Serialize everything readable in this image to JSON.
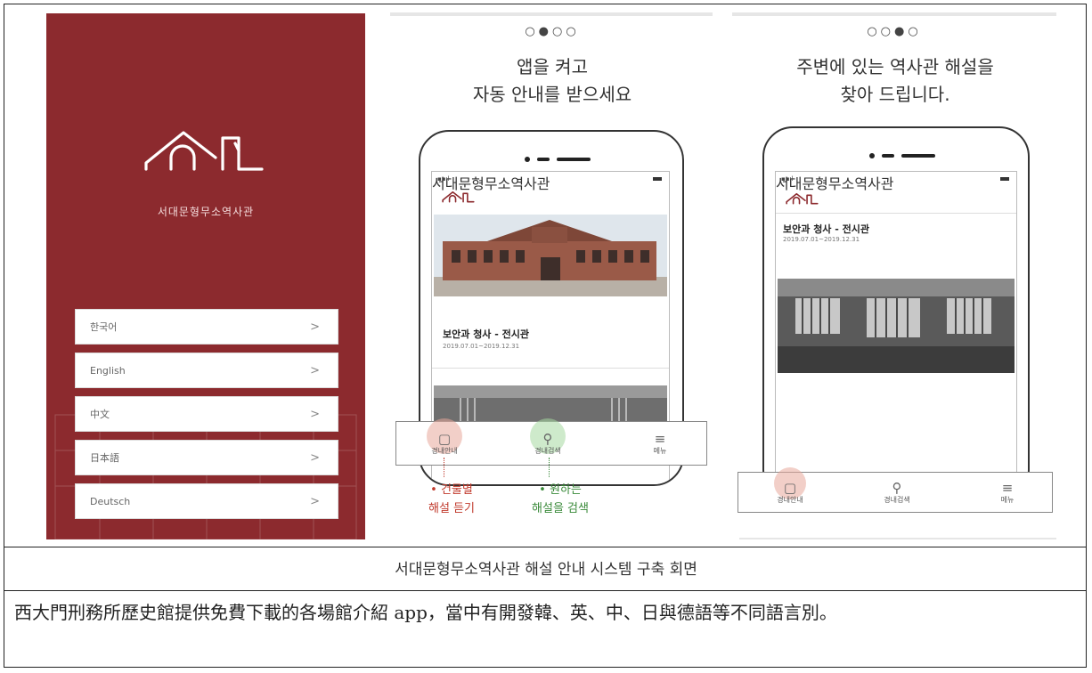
{
  "splash": {
    "museum_name": "서대문형무소역사관",
    "languages": [
      {
        "label": "한국어",
        "chevron": ">"
      },
      {
        "label": "English",
        "chevron": ">"
      },
      {
        "label": "中文",
        "chevron": ">"
      },
      {
        "label": "日本語",
        "chevron": ">"
      },
      {
        "label": "Deutsch",
        "chevron": ">"
      }
    ]
  },
  "screen2": {
    "page_indicator": "○●○○",
    "title_line1": "앱을 켜고",
    "title_line2": "자동 안내를 받으세요",
    "app_name": "서대문형무소역사관",
    "exhibit_title": "보안과 청사 - 전시관",
    "exhibit_date": "2019.07.01~2019.12.31",
    "tabs": [
      "경내안내",
      "경내검색",
      "메뉴"
    ],
    "callout_left_line1": "• 건물별",
    "callout_left_line2": "해설 듣기",
    "callout_right_line1": "• 원하는",
    "callout_right_line2": "해설을 검색",
    "callout_left_color": "#c0392b",
    "callout_right_color": "#3a8a3a"
  },
  "screen3": {
    "page_indicator": "○○●○",
    "title_line1": "주변에 있는 역사관 해설을",
    "title_line2": "찾아 드립니다.",
    "app_name": "서대문형무소역사관",
    "exhibit_title": "보안과 청사 - 전시관",
    "exhibit_date": "2019.07.01~2019.12.31",
    "tabs": [
      "경내안내",
      "경내검색",
      "메뉴"
    ]
  },
  "caption": "서대문형무소역사관 해설 안내 시스템 구축 회면",
  "paragraph": "西大門刑務所歷史館提供免費下載的各場館介紹 app，當中有開發韓、英、中、日與德語等不同語言別。",
  "colors": {
    "brand": "#8c2a2e",
    "highlight_red": "#e8a79a",
    "highlight_green": "#a6d8a0"
  }
}
